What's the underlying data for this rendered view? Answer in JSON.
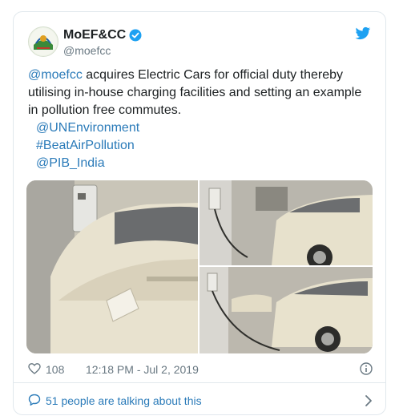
{
  "tweet": {
    "display_name": "MoEF&CC",
    "handle": "@moefcc",
    "text_mention": "@moefcc",
    "text_body": " acquires Electric Cars for official duty thereby utilising in-house charging facilities and setting an example in pollution free commutes.",
    "tags": [
      "@UNEnvironment",
      "#BeatAirPollution",
      "@PIB_India"
    ],
    "likes": "108",
    "timestamp": "12:18 PM - Jul 2, 2019",
    "talking": "51 people are talking about this"
  },
  "colors": {
    "link": "#2b7bb9",
    "verified": "#1da1f2",
    "muted": "#697882"
  },
  "icons": {
    "avatar": "moefcc-logo",
    "verified": "verified-badge-icon",
    "brand": "twitter-bird-icon",
    "like": "heart-icon",
    "info": "info-icon",
    "reply": "speech-bubble-icon",
    "more": "chevron-right-icon"
  }
}
